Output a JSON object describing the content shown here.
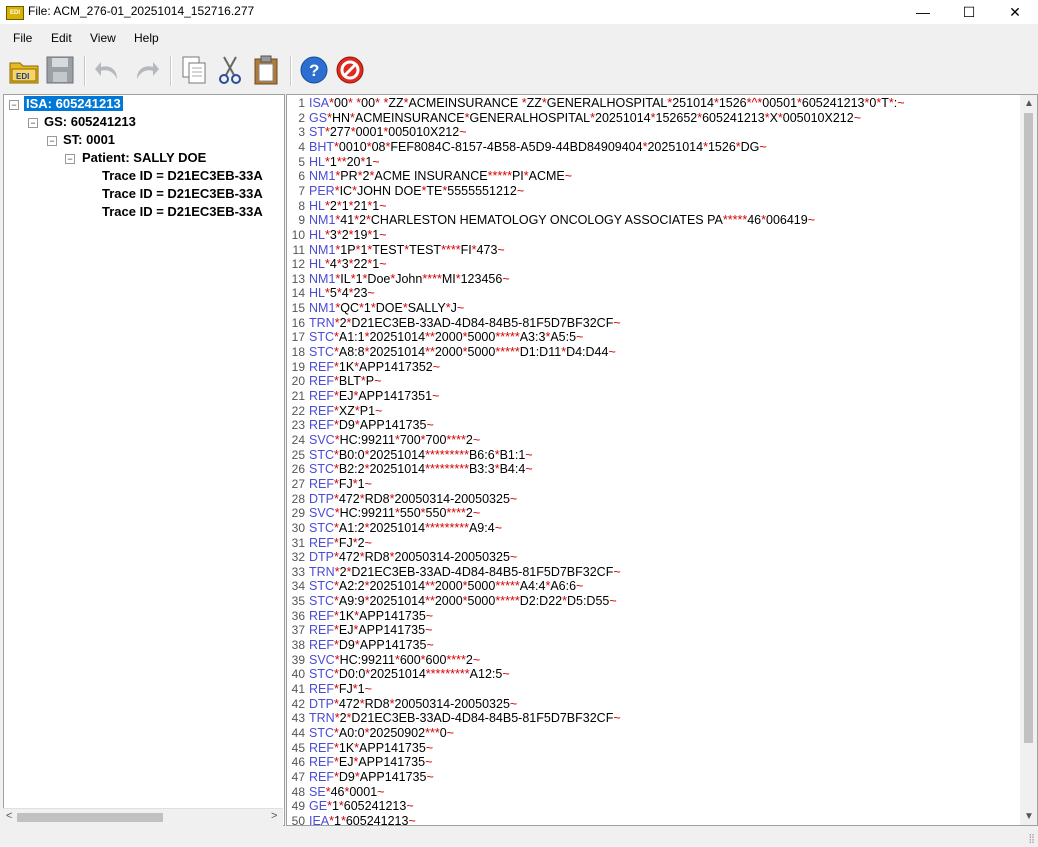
{
  "window": {
    "title": "File: ACM_276-01_20251014_152716.277",
    "app_icon_label": "EDI",
    "minimize": "—",
    "maximize": "☐",
    "close": "✕"
  },
  "menu": [
    "File",
    "Edit",
    "View",
    "Help"
  ],
  "toolbar": {
    "open_label": "EDI"
  },
  "tree": {
    "isa": "ISA: 605241213",
    "gs": "GS: 605241213",
    "st": "ST: 0001",
    "patient": "Patient: SALLY DOE",
    "trace1": "Trace ID = D21EC3EB-33A",
    "trace2": "Trace ID = D21EC3EB-33A",
    "trace3": "Trace ID = D21EC3EB-33A"
  },
  "editor_lines": [
    [
      "1",
      "ISA",
      "*00*          *00*          *ZZ*ACMEINSURANCE  *ZZ*GENERALHOSPITAL*251014*1526*^*00501*605241213*0*T*:~"
    ],
    [
      "2",
      "GS",
      "*HN*ACMEINSURANCE*GENERALHOSPITAL*20251014*152652*605241213*X*005010X212~"
    ],
    [
      "3",
      "ST",
      "*277*0001*005010X212~"
    ],
    [
      "4",
      "BHT",
      "*0010*08*FEF8084C-8157-4B58-A5D9-44BD84909404*20251014*1526*DG~"
    ],
    [
      "5",
      "HL",
      "*1**20*1~"
    ],
    [
      "6",
      "NM1",
      "*PR*2*ACME INSURANCE*****PI*ACME~"
    ],
    [
      "7",
      "PER",
      "*IC*JOHN DOE*TE*5555551212~"
    ],
    [
      "8",
      "HL",
      "*2*1*21*1~"
    ],
    [
      "9",
      "NM1",
      "*41*2*CHARLESTON HEMATOLOGY ONCOLOGY ASSOCIATES PA*****46*006419~"
    ],
    [
      "10",
      "HL",
      "*3*2*19*1~"
    ],
    [
      "11",
      "NM1",
      "*1P*1*TEST*TEST****FI*473~"
    ],
    [
      "12",
      "HL",
      "*4*3*22*1~"
    ],
    [
      "13",
      "NM1",
      "*IL*1*Doe*John****MI*123456~"
    ],
    [
      "14",
      "HL",
      "*5*4*23~"
    ],
    [
      "15",
      "NM1",
      "*QC*1*DOE*SALLY*J~"
    ],
    [
      "16",
      "TRN",
      "*2*D21EC3EB-33AD-4D84-84B5-81F5D7BF32CF~"
    ],
    [
      "17",
      "STC",
      "*A1:1*20251014**2000*5000*****A3:3*A5:5~"
    ],
    [
      "18",
      "STC",
      "*A8:8*20251014**2000*5000*****D1:D11*D4:D44~"
    ],
    [
      "19",
      "REF",
      "*1K*APP1417352~"
    ],
    [
      "20",
      "REF",
      "*BLT*P~"
    ],
    [
      "21",
      "REF",
      "*EJ*APP1417351~"
    ],
    [
      "22",
      "REF",
      "*XZ*P1~"
    ],
    [
      "23",
      "REF",
      "*D9*APP141735~"
    ],
    [
      "24",
      "SVC",
      "*HC:99211*700*700****2~"
    ],
    [
      "25",
      "STC",
      "*B0:0*20251014*********B6:6*B1:1~"
    ],
    [
      "26",
      "STC",
      "*B2:2*20251014*********B3:3*B4:4~"
    ],
    [
      "27",
      "REF",
      "*FJ*1~"
    ],
    [
      "28",
      "DTP",
      "*472*RD8*20050314-20050325~"
    ],
    [
      "29",
      "SVC",
      "*HC:99211*550*550****2~"
    ],
    [
      "30",
      "STC",
      "*A1:2*20251014*********A9:4~"
    ],
    [
      "31",
      "REF",
      "*FJ*2~"
    ],
    [
      "32",
      "DTP",
      "*472*RD8*20050314-20050325~"
    ],
    [
      "33",
      "TRN",
      "*2*D21EC3EB-33AD-4D84-84B5-81F5D7BF32CF~"
    ],
    [
      "34",
      "STC",
      "*A2:2*20251014**2000*5000*****A4:4*A6:6~"
    ],
    [
      "35",
      "STC",
      "*A9:9*20251014**2000*5000*****D2:D22*D5:D55~"
    ],
    [
      "36",
      "REF",
      "*1K*APP141735~"
    ],
    [
      "37",
      "REF",
      "*EJ*APP141735~"
    ],
    [
      "38",
      "REF",
      "*D9*APP141735~"
    ],
    [
      "39",
      "SVC",
      "*HC:99211*600*600****2~"
    ],
    [
      "40",
      "STC",
      "*D0:0*20251014*********A12:5~"
    ],
    [
      "41",
      "REF",
      "*FJ*1~"
    ],
    [
      "42",
      "DTP",
      "*472*RD8*20050314-20050325~"
    ],
    [
      "43",
      "TRN",
      "*2*D21EC3EB-33AD-4D84-84B5-81F5D7BF32CF~"
    ],
    [
      "44",
      "STC",
      "*A0:0*20250902***0~"
    ],
    [
      "45",
      "REF",
      "*1K*APP141735~"
    ],
    [
      "46",
      "REF",
      "*EJ*APP141735~"
    ],
    [
      "47",
      "REF",
      "*D9*APP141735~"
    ],
    [
      "48",
      "SE",
      "*46*0001~"
    ],
    [
      "49",
      "GE",
      "*1*605241213~"
    ],
    [
      "50",
      "IEA",
      "*1*605241213~"
    ]
  ],
  "colors": {
    "segment": "#4b4bd6",
    "delimiter": "#d40000",
    "selection": "#0078d7"
  }
}
